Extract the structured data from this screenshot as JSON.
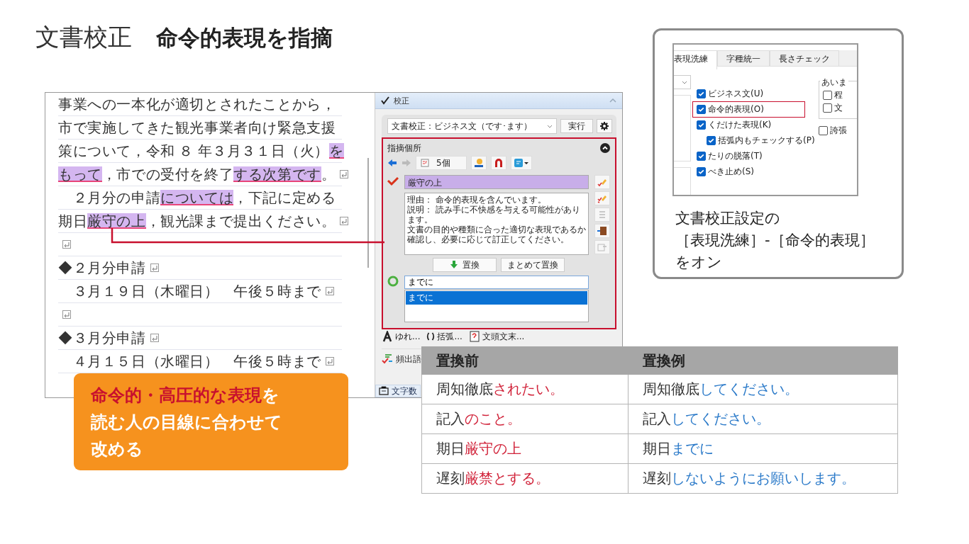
{
  "title": {
    "category": "文書校正",
    "heading": "命令的表現を指摘"
  },
  "document": {
    "lines": [
      {
        "segments": [
          {
            "text": "事業への一本化が適切とされたことから，",
            "highlighted": false
          }
        ],
        "return_mark": false
      },
      {
        "segments": [
          {
            "text": "市で実施してきた観光事業者向け緊急支援",
            "highlighted": false
          }
        ],
        "return_mark": false
      },
      {
        "segments": [
          {
            "text": "策について，令和 ８ 年３月３１日（火）",
            "highlighted": false
          },
          {
            "text": "を",
            "highlighted": true
          }
        ],
        "return_mark": false
      },
      {
        "segments": [
          {
            "text": "もって",
            "highlighted": true
          },
          {
            "text": "，市での受付を終了",
            "highlighted": false
          },
          {
            "text": "する次第です",
            "highlighted": true
          },
          {
            "text": "。",
            "highlighted": false
          }
        ],
        "return_mark": true
      },
      {
        "segments": [
          {
            "text": "　２月分の申請",
            "highlighted": false
          },
          {
            "text": "については",
            "highlighted": true
          },
          {
            "text": "，下記に定める",
            "highlighted": false
          }
        ],
        "return_mark": false
      },
      {
        "segments": [
          {
            "text": "期日",
            "highlighted": false
          },
          {
            "text": "厳守の上",
            "highlighted": true
          },
          {
            "text": "，観光課まで提出ください。",
            "highlighted": false
          }
        ],
        "return_mark": true
      },
      {
        "return_mark": true
      },
      {
        "segments": [
          {
            "text": "◆２月分申請",
            "highlighted": false
          }
        ],
        "return_mark": true
      },
      {
        "segments": [
          {
            "text": "　３月１９日（木曜日）　午後５時まで",
            "highlighted": false
          }
        ],
        "return_mark": true
      },
      {
        "return_mark": true
      },
      {
        "segments": [
          {
            "text": "◆３月分申請",
            "highlighted": false
          }
        ],
        "return_mark": true
      },
      {
        "segments": [
          {
            "text": "　４月１５日（水曜日）　午後５時まで",
            "highlighted": false
          }
        ],
        "return_mark": true
      }
    ]
  },
  "panel": {
    "title": "校正",
    "mode_select": "文書校正：ビジネス文（です･ます）",
    "run_button": "実行",
    "section_title": "指摘個所",
    "count": "5個",
    "flagged_text": "厳守の上",
    "explanation": [
      "理由： 命令的表現を含んでいます。",
      "説明： 読み手に不快感を与える可能性があります。",
      "文書の目的や種類に合った適切な表現であるか確認し、必要に応じて訂正してください。"
    ],
    "replace_button": "置換",
    "replace_all_button": "まとめて置換",
    "suggestion_input": "までに",
    "suggestions": [
      {
        "text": "までに",
        "selected": true
      }
    ],
    "tools": [
      "ゆれ...",
      "括弧...",
      "文頭文末..."
    ],
    "frequent_words": "頻出語",
    "char_count_tab": "文字数"
  },
  "settings": {
    "tabs": [
      {
        "label": "表現洗練",
        "selected": true
      },
      {
        "label": "字種統一",
        "selected": false
      },
      {
        "label": "長さチェック",
        "selected": false
      }
    ],
    "checkboxes": [
      {
        "label": "ビジネス文(U)",
        "checked": true,
        "emphasized": false
      },
      {
        "label": "命令的表現(O)",
        "checked": true,
        "emphasized": true
      },
      {
        "label": "くだけた表現(K)",
        "checked": true,
        "emphasized": false,
        "children": [
          {
            "label": "括弧内もチェックする(P)",
            "checked": true
          }
        ]
      },
      {
        "label": "たりの脱落(T)",
        "checked": true,
        "emphasized": false
      },
      {
        "label": "べき止め(S)",
        "checked": true,
        "emphasized": false
      }
    ],
    "group_title": "あいま",
    "group_checkboxes": [
      {
        "label": "程",
        "checked": false
      },
      {
        "label": "文",
        "checked": false
      }
    ],
    "extra_checkbox": {
      "label": "誇張",
      "checked": false
    },
    "caption": [
      "文書校正設定の",
      "［表現洗練］-［命令的表現］",
      "をオン"
    ]
  },
  "callout": {
    "lines": [
      [
        {
          "text": "命令的・高圧的な表現",
          "emphasis": true
        },
        {
          "text": "を",
          "emphasis": false
        }
      ],
      [
        {
          "text": "読む人の目線に合わせて",
          "emphasis": false
        }
      ],
      [
        {
          "text": "改める",
          "emphasis": false
        }
      ]
    ]
  },
  "table": {
    "columns": [
      "置換前",
      "置換例"
    ],
    "rows": [
      {
        "before": [
          {
            "text": "周知徹底",
            "marked": false
          },
          {
            "text": "されたい。",
            "marked": true
          }
        ],
        "after": [
          {
            "text": "周知徹底",
            "marked": false
          },
          {
            "text": "してください。",
            "marked": true
          }
        ]
      },
      {
        "before": [
          {
            "text": "記入",
            "marked": false
          },
          {
            "text": "のこと。",
            "marked": true
          }
        ],
        "after": [
          {
            "text": "記入",
            "marked": false
          },
          {
            "text": "してください。",
            "marked": true
          }
        ]
      },
      {
        "before": [
          {
            "text": "期日",
            "marked": false
          },
          {
            "text": "厳守の上",
            "marked": true
          }
        ],
        "after": [
          {
            "text": "期日",
            "marked": false
          },
          {
            "text": "までに",
            "marked": true
          }
        ]
      },
      {
        "before": [
          {
            "text": "遅刻",
            "marked": false
          },
          {
            "text": "厳禁とする。",
            "marked": true
          }
        ],
        "after": [
          {
            "text": "遅刻",
            "marked": false
          },
          {
            "text": "しないようにお願いします。",
            "marked": true
          }
        ]
      }
    ]
  }
}
